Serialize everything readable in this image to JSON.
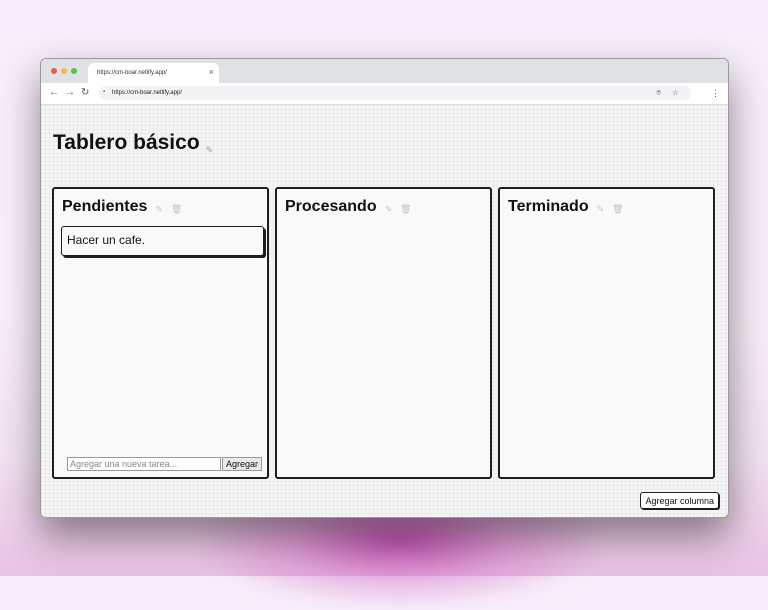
{
  "browser": {
    "tab_title": "https://cm-boar.netlify.app/",
    "tab_close": "×",
    "url": "https://cm-boar.netlify.app/"
  },
  "icons": {
    "back": "arrow-left-icon",
    "forward": "arrow-right-icon",
    "reload": "reload-icon",
    "lock": "lock-icon",
    "share": "share-icon",
    "bookmark": "star-icon",
    "menu": "kebab-menu-icon",
    "edit": "edit-icon",
    "delete": "trash-icon"
  },
  "board": {
    "title": "Tablero básico"
  },
  "columns": [
    {
      "title": "Pendientes",
      "tasks": [
        "Hacer un cafe."
      ],
      "input_placeholder": "Agregar una nueva tarea...",
      "add_label": "Agregar"
    },
    {
      "title": "Procesando",
      "tasks": []
    },
    {
      "title": "Terminado",
      "tasks": []
    }
  ],
  "add_column_label": "Agregar columna"
}
